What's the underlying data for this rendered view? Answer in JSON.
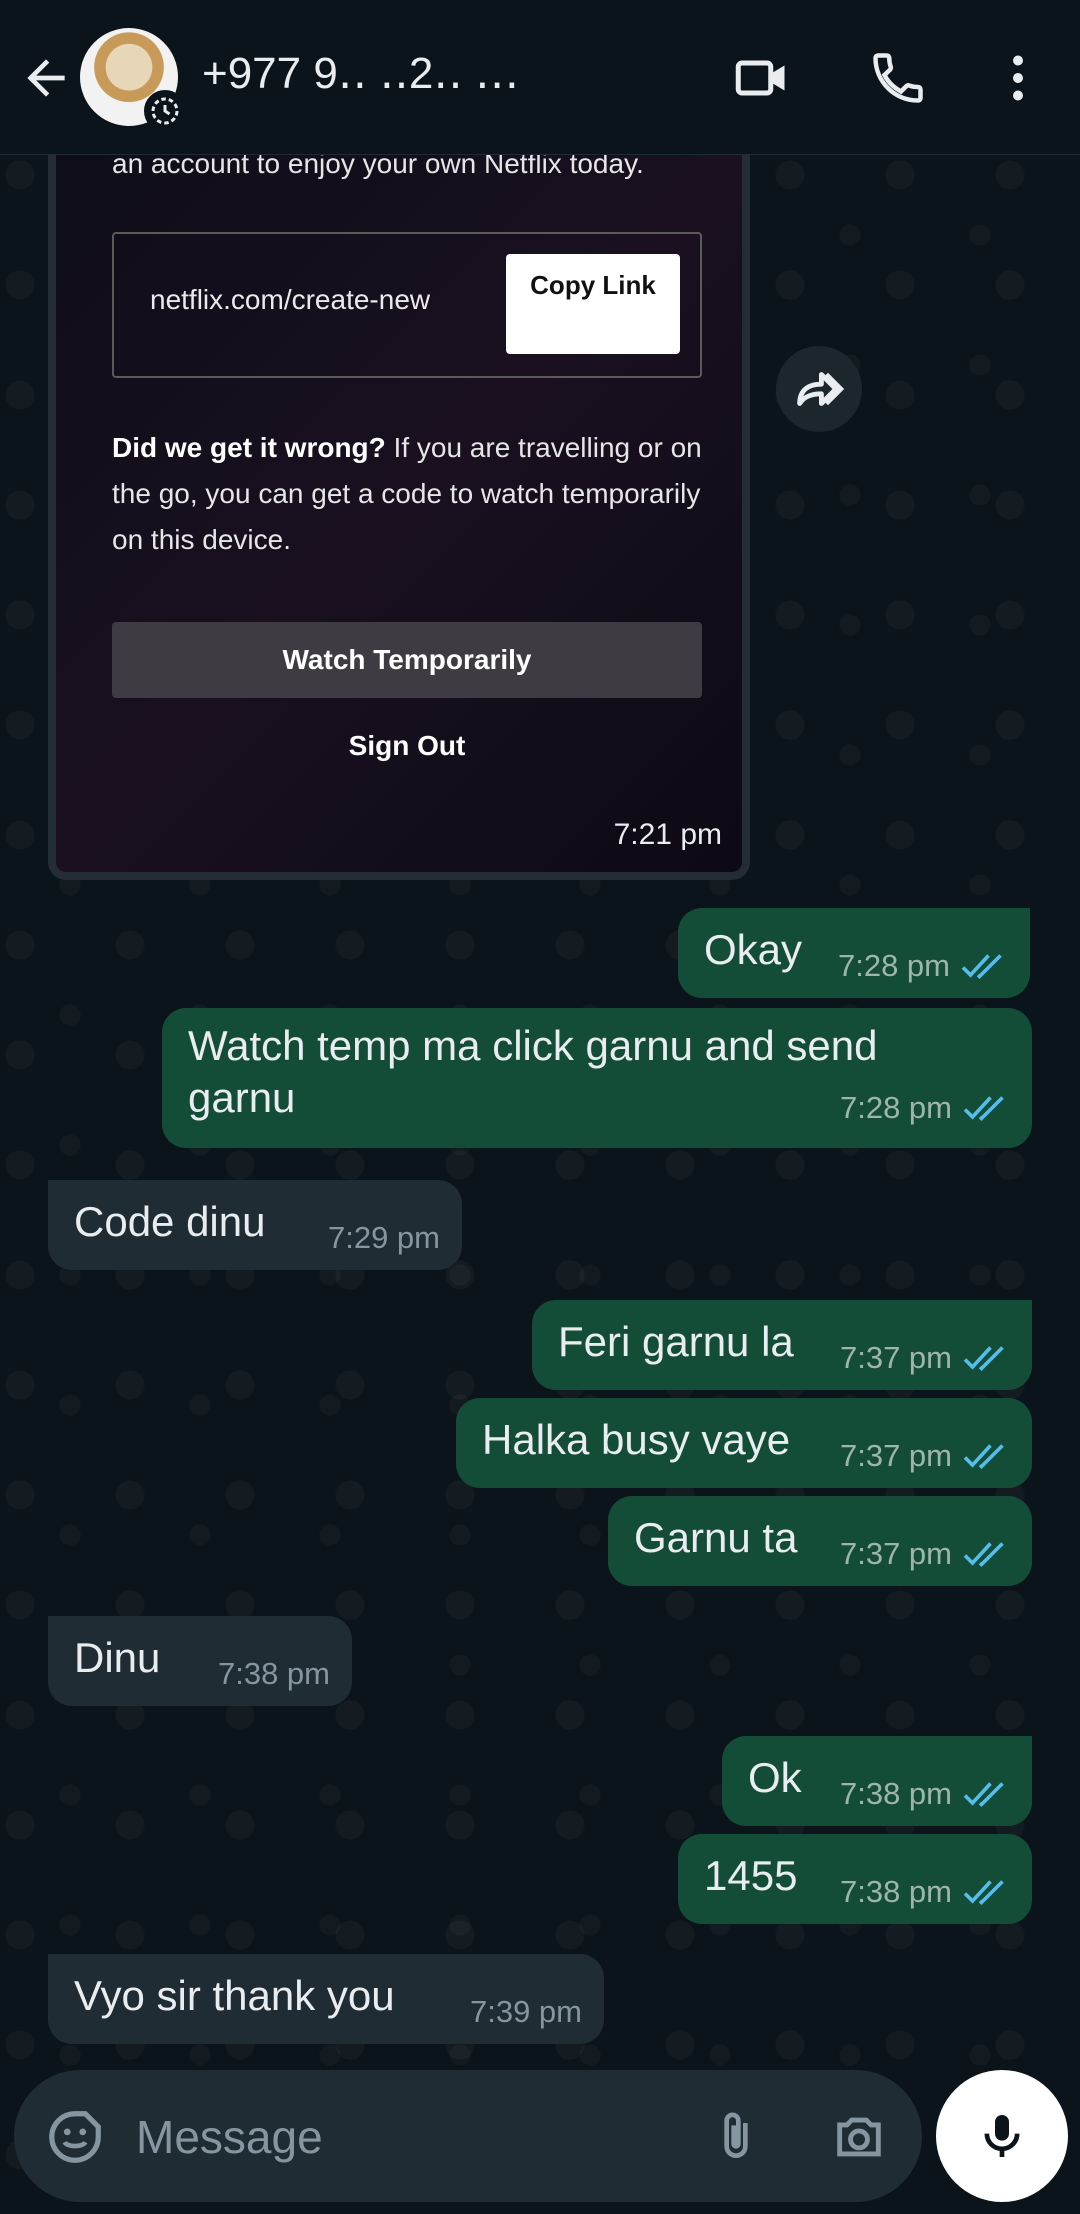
{
  "header": {
    "contact": "+977 9․․ ․․2․․ ․․․"
  },
  "netflix_card": {
    "top_text": "an account to enjoy your own Netflix today.",
    "link": "netflix.com/create-new",
    "copy_button": "Copy Link",
    "para_bold": "Did we get it wrong?",
    "para_rest": " If you are travelling or on the go, you can get a code to watch temporarily on this device.",
    "watch_button": "Watch Temporarily",
    "sign_out": "Sign Out",
    "time": "7:21 pm"
  },
  "messages": [
    {
      "dir": "out",
      "text": "Okay",
      "time": "7:28 pm"
    },
    {
      "dir": "out",
      "text": "Watch temp ma click garnu and send garnu",
      "time": "7:28 pm"
    },
    {
      "dir": "in",
      "text": "Code dinu",
      "time": "7:29 pm"
    },
    {
      "dir": "out",
      "text": "Feri garnu la",
      "time": "7:37 pm"
    },
    {
      "dir": "out",
      "text": "Halka busy vaye",
      "time": "7:37 pm"
    },
    {
      "dir": "out",
      "text": "Garnu ta",
      "time": "7:37 pm"
    },
    {
      "dir": "in",
      "text": "Dinu",
      "time": "7:38 pm"
    },
    {
      "dir": "out",
      "text": "Ok",
      "time": "7:38 pm"
    },
    {
      "dir": "out",
      "text": "1455",
      "time": "7:38 pm"
    },
    {
      "dir": "in",
      "text": "Vyo sir thank you",
      "time": "7:39 pm"
    }
  ],
  "input": {
    "placeholder": "Message"
  },
  "colors": {
    "outgoing_bubble": "#144d37",
    "incoming_bubble": "#1f2c34",
    "read_ticks": "#53bdeb",
    "background": "#0b141a"
  },
  "icons": [
    "back-arrow-icon",
    "video-call-icon",
    "phone-icon",
    "more-vert-icon",
    "forward-icon",
    "sticker-icon",
    "attach-icon",
    "camera-icon",
    "mic-icon",
    "double-check-icon"
  ]
}
